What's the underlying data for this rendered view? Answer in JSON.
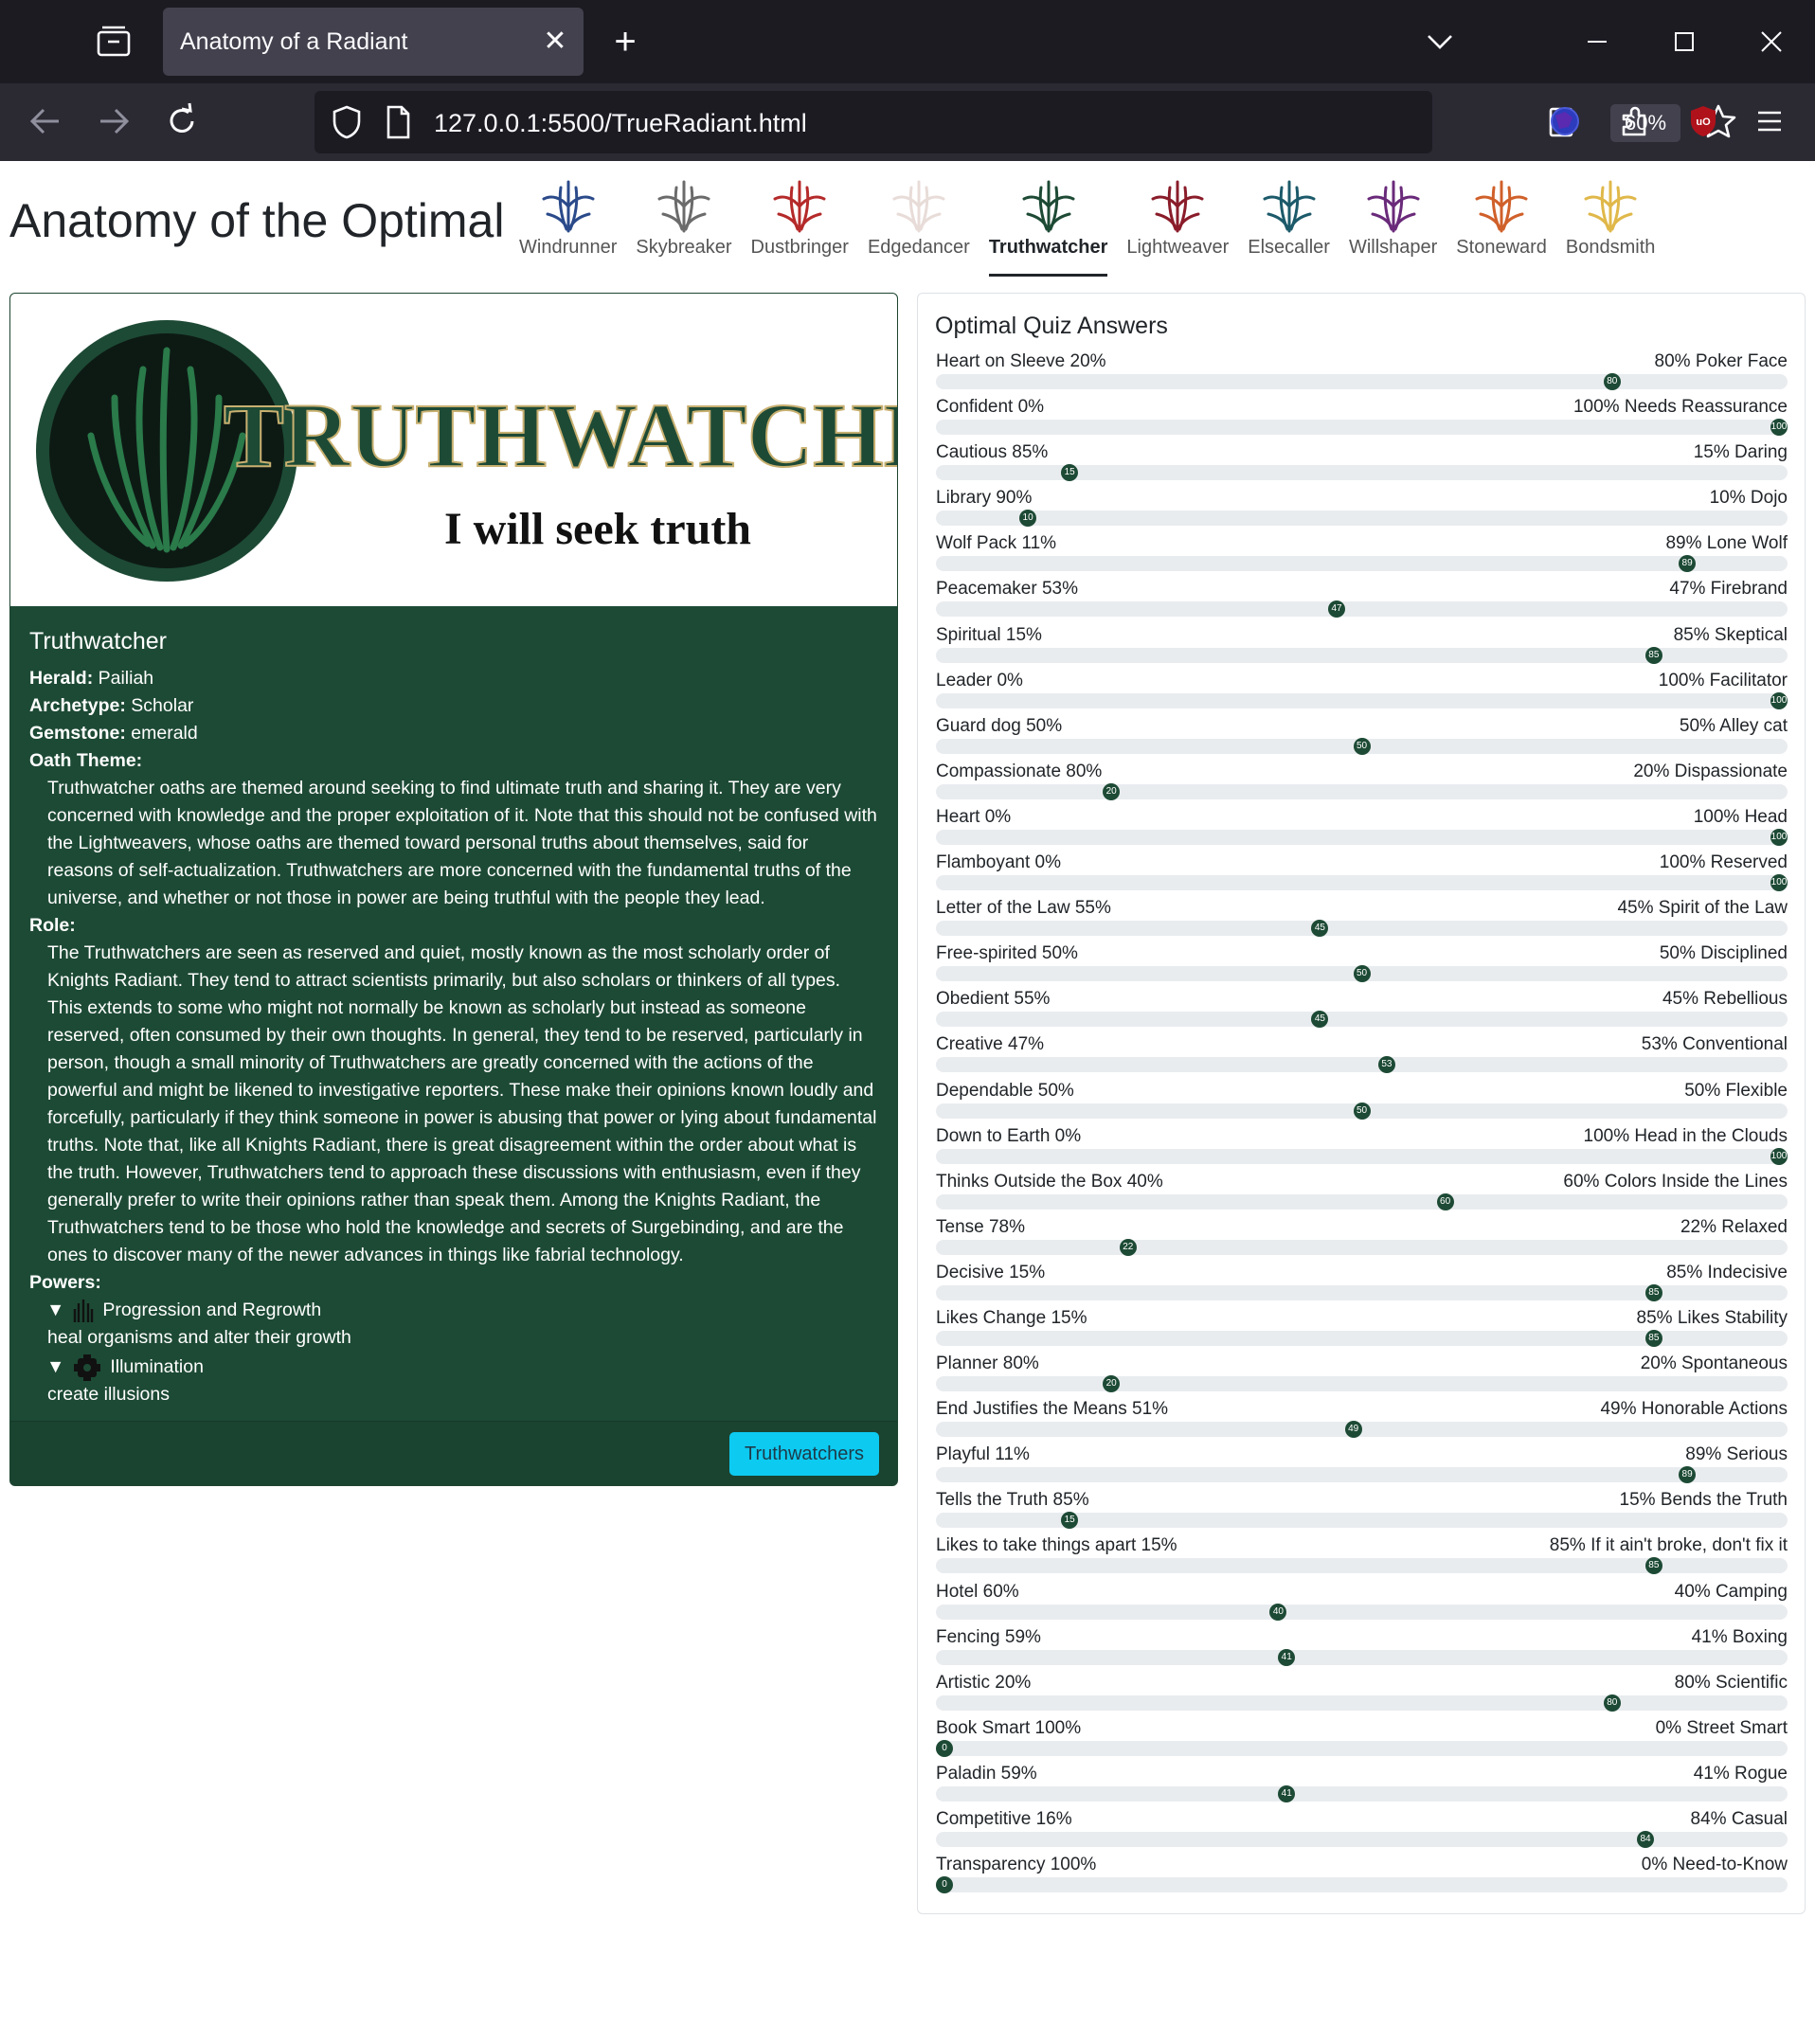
{
  "browser": {
    "tab_title": "Anatomy of a Radiant",
    "url": "127.0.0.1:5500/TrueRadiant.html",
    "zoom": "60%"
  },
  "page": {
    "heading": "Anatomy of the Optimal",
    "orders": [
      {
        "name": "Windrunner",
        "color": "#2a4a8a",
        "active": false
      },
      {
        "name": "Skybreaker",
        "color": "#6b6b6b",
        "active": false
      },
      {
        "name": "Dustbringer",
        "color": "#b52a2a",
        "active": false
      },
      {
        "name": "Edgedancer",
        "color": "#e8dcd8",
        "active": false
      },
      {
        "name": "Truthwatcher",
        "color": "#1d4a35",
        "active": true
      },
      {
        "name": "Lightweaver",
        "color": "#8a1c2a",
        "active": false
      },
      {
        "name": "Elsecaller",
        "color": "#1c5a6a",
        "active": false
      },
      {
        "name": "Willshaper",
        "color": "#6a2a7a",
        "active": false
      },
      {
        "name": "Stoneward",
        "color": "#d0602a",
        "active": false
      },
      {
        "name": "Bondsmith",
        "color": "#e0b84a",
        "active": false
      }
    ]
  },
  "card": {
    "banner_title": "TRUTHWATCHER",
    "banner_motto": "I will seek truth",
    "title": "Truthwatcher",
    "herald_label": "Herald:",
    "herald": "Pailiah",
    "archetype_label": "Archetype:",
    "archetype": "Scholar",
    "gemstone_label": "Gemstone:",
    "gemstone": "emerald",
    "oath_label": "Oath Theme:",
    "oath": "Truthwatcher oaths are themed around seeking to find ultimate truth and sharing it. They are very concerned with knowledge and the proper exploitation of it. Note that this should not be confused with the Lightweavers, whose oaths are themed toward personal truths about themselves, said for reasons of self-actualization. Truthwatchers are more concerned with the fundamental truths of the universe, and whether or not those in power are being truthful with the people they lead.",
    "role_label": "Role:",
    "role": "The Truthwatchers are seen as reserved and quiet, mostly known as the most scholarly order of Knights Radiant. They tend to attract scientists primarily, but also scholars or thinkers of all types. This extends to some who might not normally be known as scholarly but instead as someone reserved, often consumed by their own thoughts. In general, they tend to be reserved, particularly in person, though a small minority of Truthwatchers are greatly concerned with the actions of the powerful and might be likened to investigative reporters. These make their opinions known loudly and forcefully, particularly if they think someone in power is abusing that power or lying about fundamental truths. Note that, like all Knights Radiant, there is great disagreement within the order about what is the truth. However, Truthwatchers tend to approach these discussions with enthusiasm, even if they generally prefer to write their opinions rather than speak them. Among the Knights Radiant, the Truthwatchers tend to be those who hold the knowledge and secrets of Surgebinding, and are the ones to discover many of the newer advances in things like fabrial technology.",
    "powers_label": "Powers:",
    "powers": [
      {
        "name": "Progression and Regrowth",
        "desc": "heal organisms and alter their growth",
        "icon": "progression-glyph-icon"
      },
      {
        "name": "Illumination",
        "desc": "create illusions",
        "icon": "illumination-glyph-icon"
      }
    ],
    "button": "Truthwatchers"
  },
  "quiz": {
    "title": "Optimal Quiz Answers",
    "rows": [
      {
        "left": "Heart on Sleeve 20%",
        "right": "80% Poker Face",
        "value": 80
      },
      {
        "left": "Confident 0%",
        "right": "100% Needs Reassurance",
        "value": 100
      },
      {
        "left": "Cautious 85%",
        "right": "15% Daring",
        "value": 15
      },
      {
        "left": "Library 90%",
        "right": "10% Dojo",
        "value": 10
      },
      {
        "left": "Wolf Pack 11%",
        "right": "89% Lone Wolf",
        "value": 89
      },
      {
        "left": "Peacemaker 53%",
        "right": "47% Firebrand",
        "value": 47
      },
      {
        "left": "Spiritual 15%",
        "right": "85% Skeptical",
        "value": 85
      },
      {
        "left": "Leader 0%",
        "right": "100% Facilitator",
        "value": 100
      },
      {
        "left": "Guard dog 50%",
        "right": "50% Alley cat",
        "value": 50
      },
      {
        "left": "Compassionate 80%",
        "right": "20% Dispassionate",
        "value": 20
      },
      {
        "left": "Heart 0%",
        "right": "100% Head",
        "value": 100
      },
      {
        "left": "Flamboyant 0%",
        "right": "100% Reserved",
        "value": 100
      },
      {
        "left": "Letter of the Law 55%",
        "right": "45% Spirit of the Law",
        "value": 45
      },
      {
        "left": "Free-spirited 50%",
        "right": "50% Disciplined",
        "value": 50
      },
      {
        "left": "Obedient 55%",
        "right": "45% Rebellious",
        "value": 45
      },
      {
        "left": "Creative 47%",
        "right": "53% Conventional",
        "value": 53
      },
      {
        "left": "Dependable 50%",
        "right": "50% Flexible",
        "value": 50
      },
      {
        "left": "Down to Earth 0%",
        "right": "100% Head in the Clouds",
        "value": 100
      },
      {
        "left": "Thinks Outside the Box 40%",
        "right": "60% Colors Inside the Lines",
        "value": 60
      },
      {
        "left": "Tense 78%",
        "right": "22% Relaxed",
        "value": 22
      },
      {
        "left": "Decisive 15%",
        "right": "85% Indecisive",
        "value": 85
      },
      {
        "left": "Likes Change 15%",
        "right": "85% Likes Stability",
        "value": 85
      },
      {
        "left": "Planner 80%",
        "right": "20% Spontaneous",
        "value": 20
      },
      {
        "left": "End Justifies the Means 51%",
        "right": "49% Honorable Actions",
        "value": 49
      },
      {
        "left": "Playful 11%",
        "right": "89% Serious",
        "value": 89
      },
      {
        "left": "Tells the Truth 85%",
        "right": "15% Bends the Truth",
        "value": 15
      },
      {
        "left": "Likes to take things apart 15%",
        "right": "85% If it ain't broke, don't fix it",
        "value": 85
      },
      {
        "left": "Hotel 60%",
        "right": "40% Camping",
        "value": 40
      },
      {
        "left": "Fencing 59%",
        "right": "41% Boxing",
        "value": 41
      },
      {
        "left": "Artistic 20%",
        "right": "80% Scientific",
        "value": 80
      },
      {
        "left": "Book Smart 100%",
        "right": "0% Street Smart",
        "value": 0
      },
      {
        "left": "Paladin 59%",
        "right": "41% Rogue",
        "value": 41
      },
      {
        "left": "Competitive 16%",
        "right": "84% Casual",
        "value": 84
      },
      {
        "left": "Transparency 100%",
        "right": "0% Need-to-Know",
        "value": 0
      }
    ]
  }
}
